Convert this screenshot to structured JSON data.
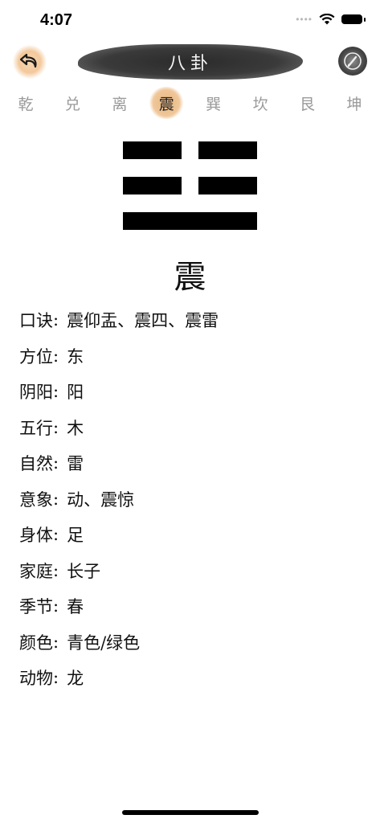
{
  "status_bar": {
    "time": "4:07"
  },
  "header": {
    "title": "八卦",
    "back_icon": "back-arrow-icon",
    "brush_icon": "brush-icon"
  },
  "tabs": [
    {
      "label": "乾",
      "active": false
    },
    {
      "label": "兑",
      "active": false
    },
    {
      "label": "离",
      "active": false
    },
    {
      "label": "震",
      "active": true
    },
    {
      "label": "巽",
      "active": false
    },
    {
      "label": "坎",
      "active": false
    },
    {
      "label": "艮",
      "active": false
    },
    {
      "label": "坤",
      "active": false
    }
  ],
  "trigram": {
    "name": "震",
    "lines_top_to_bottom": [
      "broken",
      "broken",
      "solid"
    ]
  },
  "properties": [
    {
      "label": "口诀",
      "value": "震仰盂、震四、震雷"
    },
    {
      "label": "方位",
      "value": "东"
    },
    {
      "label": "阴阳",
      "value": "阳"
    },
    {
      "label": "五行",
      "value": "木"
    },
    {
      "label": "自然",
      "value": "雷"
    },
    {
      "label": "意象",
      "value": "动、震惊"
    },
    {
      "label": "身体",
      "value": "足"
    },
    {
      "label": "家庭",
      "value": "长子"
    },
    {
      "label": "季节",
      "value": "春"
    },
    {
      "label": "颜色",
      "value": "青色/绿色"
    },
    {
      "label": "动物",
      "value": "龙"
    }
  ],
  "separator": ":",
  "colors": {
    "accent": "#f0c79a",
    "active_tab_text": "#222222",
    "inactive_tab_text": "#9a9a9a",
    "title_brush": "#2b2b2b"
  }
}
